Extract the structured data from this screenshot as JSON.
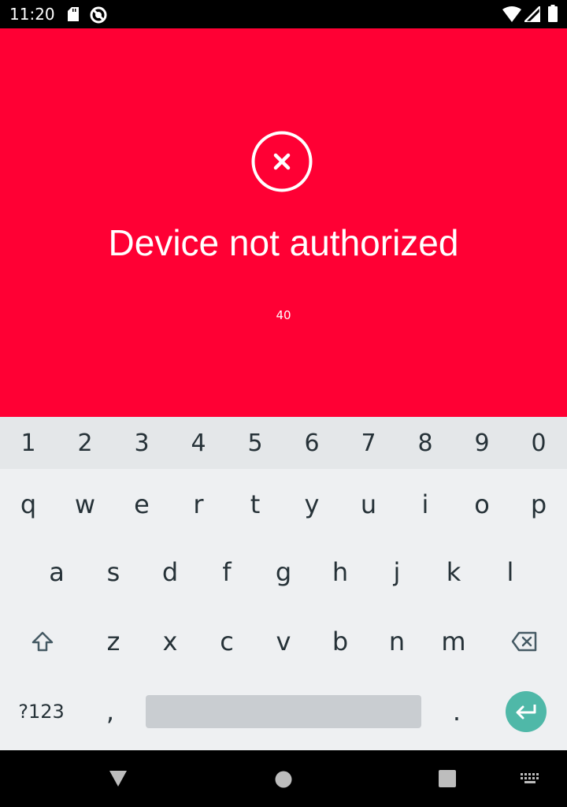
{
  "status_bar": {
    "time": "11:20",
    "icons": [
      "sd-card-icon",
      "do-not-disturb-icon",
      "wifi-icon",
      "cell-signal-icon",
      "battery-icon"
    ]
  },
  "alert": {
    "icon": "error-circle-x-icon",
    "title": "Device not authorized",
    "code": "40",
    "background_color": "#ff0034"
  },
  "keyboard": {
    "number_row": [
      "1",
      "2",
      "3",
      "4",
      "5",
      "6",
      "7",
      "8",
      "9",
      "0"
    ],
    "row1": [
      "q",
      "w",
      "e",
      "r",
      "t",
      "y",
      "u",
      "i",
      "o",
      "p"
    ],
    "row2": [
      "a",
      "s",
      "d",
      "f",
      "g",
      "h",
      "j",
      "k",
      "l"
    ],
    "row3": [
      "z",
      "x",
      "c",
      "v",
      "b",
      "n",
      "m"
    ],
    "symbols_label": "?123",
    "comma": ",",
    "period": ".",
    "enter_color": "#4fb8a8"
  },
  "nav_bar": {
    "icons": [
      "back-icon",
      "home-icon",
      "recents-icon",
      "keyboard-switch-icon"
    ]
  }
}
